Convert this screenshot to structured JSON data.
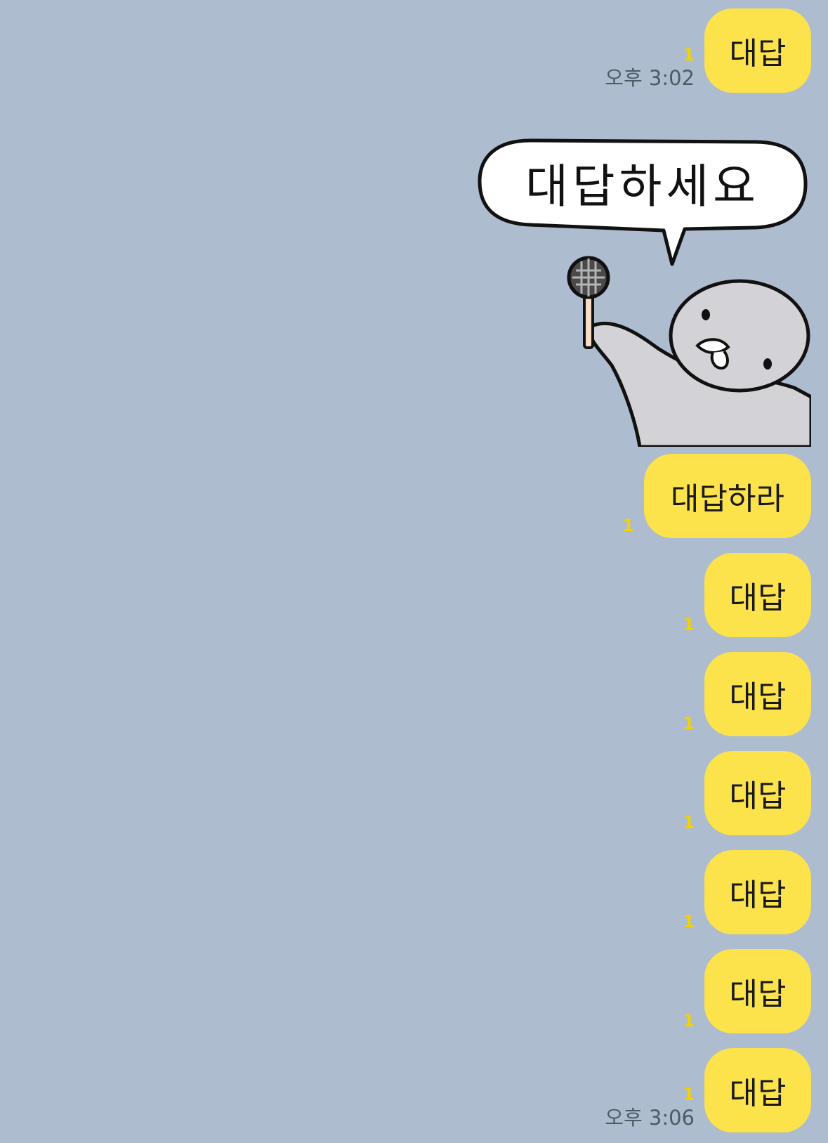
{
  "colors": {
    "background": "#adbccf",
    "bubble": "#fce34b",
    "unread": "#f2d200"
  },
  "messages": [
    {
      "text": "대답",
      "unread": "1",
      "time": "오후 3:02"
    },
    {
      "text": "대답하라",
      "unread": "1"
    },
    {
      "text": "대답",
      "unread": "1"
    },
    {
      "text": "대답",
      "unread": "1"
    },
    {
      "text": "대답",
      "unread": "1"
    },
    {
      "text": "대답",
      "unread": "1"
    },
    {
      "text": "대답",
      "unread": "1"
    },
    {
      "text": "대답",
      "unread": "1",
      "time": "오후 3:06"
    }
  ],
  "sticker": {
    "speech_text": "대답하세요",
    "icons": [
      "speech-bubble-icon",
      "microphone-icon",
      "character-icon"
    ]
  }
}
